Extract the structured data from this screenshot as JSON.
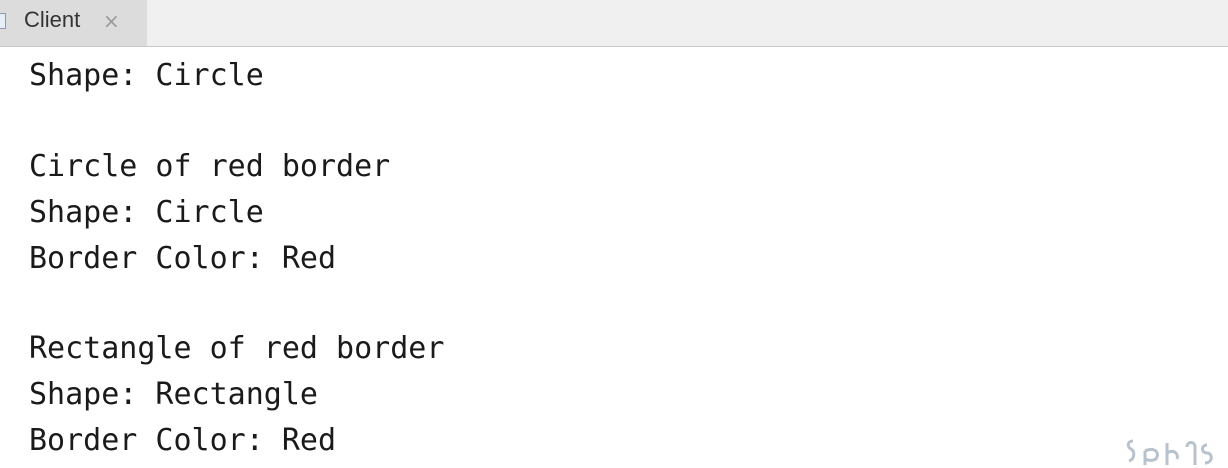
{
  "tab": {
    "label": "Client",
    "close_glyph": "×",
    "icon": "console-icon"
  },
  "console": {
    "lines": [
      "Shape: Circle",
      "",
      "Circle of red border",
      "Shape: Circle",
      "Border Color: Red",
      "",
      "Rectangle of red border",
      "Shape: Rectangle",
      "Border Color: Red"
    ]
  },
  "colors": {
    "tab_active": "#dcdcdc",
    "tabbar": "#f0f0f0",
    "text": "#1a1a1a"
  }
}
